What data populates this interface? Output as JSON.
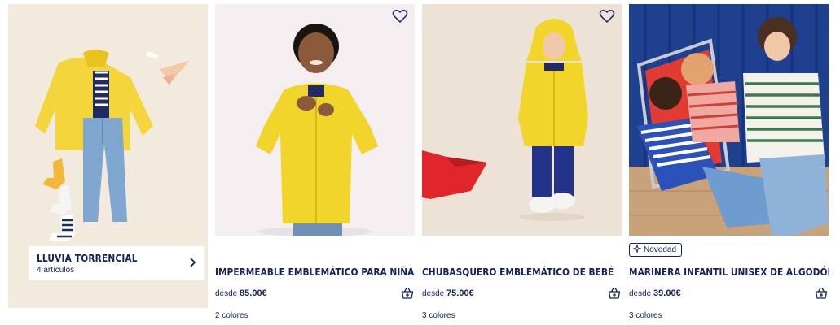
{
  "promo": {
    "title": "LLUVIA TORRENCIAL",
    "count": "4 artículos",
    "arrow_icon": "chevron-right-icon"
  },
  "products": [
    {
      "title": "IMPERMEABLE EMBLEMÁTICO PARA NIÑA…",
      "price_prefix": "desde",
      "price": "85.00€",
      "colors": "2 colores",
      "badge": ""
    },
    {
      "title": "CHUBASQUERO EMBLEMÁTICO DE BEBÉ",
      "price_prefix": "desde",
      "price": "75.00€",
      "colors": "3 colores",
      "badge": ""
    },
    {
      "title": "MARINERA INFANTIL UNISEX DE ALGODÓN…",
      "price_prefix": "desde",
      "price": "39.00€",
      "colors": "3 colores",
      "badge": "Novedad"
    }
  ],
  "icons": {
    "favorite": "heart-outline-icon",
    "basket": "basket-plus-icon",
    "badge": "sparkle-icon"
  },
  "colors": {
    "navy": "#14245c",
    "raincoat_yellow": "#f2d52a",
    "promo_bg": "#f3ecdf"
  }
}
